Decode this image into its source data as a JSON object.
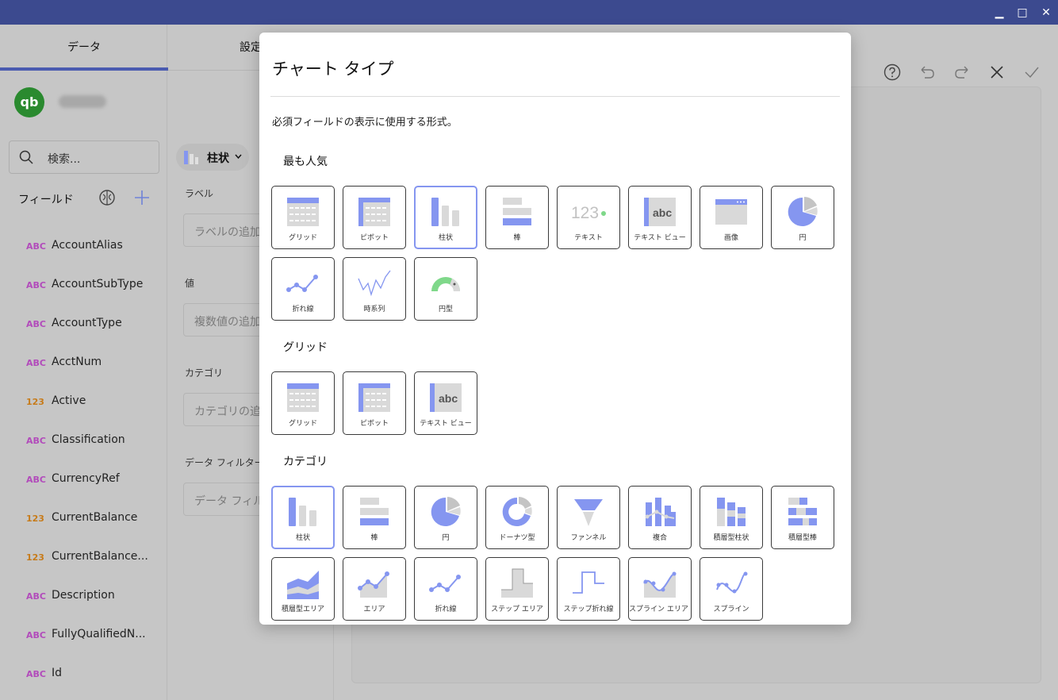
{
  "window": {
    "minimize": "▁",
    "maximize": "□",
    "close": "✕"
  },
  "tabs": {
    "data": "データ",
    "settings": "設定"
  },
  "datasource": {
    "logo": "qb"
  },
  "search": {
    "placeholder": "検索..."
  },
  "fields": {
    "title": "フィールド",
    "items": [
      {
        "type": "ABC",
        "name": "AccountAlias"
      },
      {
        "type": "ABC",
        "name": "AccountSubType"
      },
      {
        "type": "ABC",
        "name": "AccountType"
      },
      {
        "type": "ABC",
        "name": "AcctNum"
      },
      {
        "type": "123",
        "name": "Active"
      },
      {
        "type": "ABC",
        "name": "Classification"
      },
      {
        "type": "ABC",
        "name": "CurrencyRef"
      },
      {
        "type": "123",
        "name": "CurrentBalance"
      },
      {
        "type": "123",
        "name": "CurrentBalance..."
      },
      {
        "type": "ABC",
        "name": "Description"
      },
      {
        "type": "ABC",
        "name": "FullyQualifiedN..."
      },
      {
        "type": "ABC",
        "name": "Id"
      }
    ]
  },
  "config": {
    "chart_type": "柱状",
    "label_title": "ラベル",
    "label_placeholder": "ラベルの追加",
    "value_title": "値",
    "value_placeholder": "複数値の追加",
    "category_title": "カテゴリ",
    "category_placeholder": "カテゴリの追加",
    "filter_title": "データ フィルター",
    "filter_placeholder": "データ フィルター"
  },
  "modal": {
    "title": "チャート タイプ",
    "subtitle": "必須フィールドの表示に使用する形式。",
    "sections": {
      "popular": "最も人気",
      "grid": "グリッド",
      "category": "カテゴリ"
    },
    "popular": [
      {
        "label": "グリッド",
        "icon": "grid"
      },
      {
        "label": "ピボット",
        "icon": "pivot"
      },
      {
        "label": "柱状",
        "icon": "column",
        "selected": true
      },
      {
        "label": "棒",
        "icon": "bar"
      },
      {
        "label": "テキスト",
        "icon": "text"
      },
      {
        "label": "テキスト ビュー",
        "icon": "textview"
      },
      {
        "label": "画像",
        "icon": "image"
      },
      {
        "label": "円",
        "icon": "pie"
      },
      {
        "label": "折れ線",
        "icon": "line"
      },
      {
        "label": "時系列",
        "icon": "timeseries"
      },
      {
        "label": "円型",
        "icon": "gauge"
      }
    ],
    "grid": [
      {
        "label": "グリッド",
        "icon": "grid"
      },
      {
        "label": "ピボット",
        "icon": "pivot"
      },
      {
        "label": "テキスト ビュー",
        "icon": "textview"
      }
    ],
    "category": [
      {
        "label": "柱状",
        "icon": "column",
        "selected": true
      },
      {
        "label": "棒",
        "icon": "bar"
      },
      {
        "label": "円",
        "icon": "pie"
      },
      {
        "label": "ドーナツ型",
        "icon": "donut"
      },
      {
        "label": "ファンネル",
        "icon": "funnel"
      },
      {
        "label": "複合",
        "icon": "composite"
      },
      {
        "label": "積層型柱状",
        "icon": "stackedcolumn"
      },
      {
        "label": "積層型棒",
        "icon": "stackedbar"
      },
      {
        "label": "積層型エリア",
        "icon": "stackedarea"
      },
      {
        "label": "エリア",
        "icon": "area"
      },
      {
        "label": "折れ線",
        "icon": "line"
      },
      {
        "label": "ステップ エリア",
        "icon": "steparea"
      },
      {
        "label": "ステップ折れ線",
        "icon": "stepline"
      },
      {
        "label": "スプライン エリア チ...",
        "icon": "splinearea"
      },
      {
        "label": "スプライン",
        "icon": "spline"
      }
    ],
    "icon_text_123": "123",
    "icon_text_abc": "abc"
  },
  "colors": {
    "accent": "#8596f0",
    "titlebar": "#3c4a8f",
    "gauge": "#7fd88a"
  }
}
